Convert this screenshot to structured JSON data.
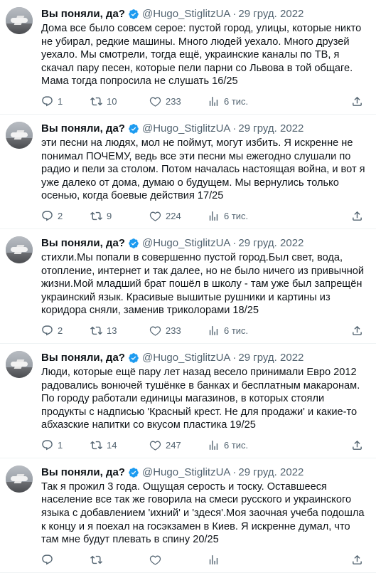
{
  "colors": {
    "text": "#0f1419",
    "muted": "#536471",
    "verified": "#1d9bf0",
    "divider": "#eff3f4"
  },
  "icons": {
    "reply": "reply-icon",
    "retweet": "retweet-icon",
    "like": "heart-icon",
    "views": "views-chart-icon",
    "share": "share-icon",
    "verified": "verified-badge-icon"
  },
  "tweets": [
    {
      "name": "Вы поняли, да?",
      "handle": "@Hugo_StiglitzUA",
      "dot": "·",
      "date": "29 груд. 2022",
      "text": "Дома все было совсем серое: пустой город, улицы, которые никто не убирал, редкие машины. Много людей уехало. Много друзей уехало. Мы смотрели, тогда ещё, украинские каналы по ТВ, я скачал пару песен, которые пели парни со Львова в той общаге. Мама тогда попросила не слушать 16/25",
      "replies": "1",
      "retweets": "10",
      "likes": "233",
      "views": "6 тис."
    },
    {
      "name": "Вы поняли, да?",
      "handle": "@Hugo_StiglitzUA",
      "dot": "·",
      "date": "29 груд. 2022",
      "text": "эти песни на людях, мол не поймут, могут избить. Я искренне не понимал ПОЧЕМУ, ведь все эти песни мы ежегодно слушали по радио и пели за столом. Потом началась настоящая война, и вот я уже далеко от дома, думаю о будущем. Мы вернулись только осенью, когда боевые действия 17/25",
      "replies": "2",
      "retweets": "9",
      "likes": "224",
      "views": "6 тис."
    },
    {
      "name": "Вы поняли, да?",
      "handle": "@Hugo_StiglitzUA",
      "dot": "·",
      "date": "29 груд. 2022",
      "text": "стихли.Мы попали в совершенно пустой город.Был свет, вода, отопление, интернет и так далее, но не было ничего из привычной жизни.Мой младший брат пошёл в школу - там уже был запрещён украинский язык. Красивые вышитые рушники и картины из коридора сняли, заменив триколорами 18/25",
      "replies": "2",
      "retweets": "13",
      "likes": "233",
      "views": "6 тис."
    },
    {
      "name": "Вы поняли, да?",
      "handle": "@Hugo_StiglitzUA",
      "dot": "·",
      "date": "29 груд. 2022",
      "text": "Люди, которые ещё пару лет назад весело принимали Евро 2012 радовались вонючей тушёнке в банках и бесплатным макаронам. По городу работали единицы магазинов, в которых стояли продукты с надписью 'Красный крест. Не для продажи' и какие-то абхазские напитки со вкусом пластика 19/25",
      "replies": "1",
      "retweets": "14",
      "likes": "247",
      "views": "6 тис."
    },
    {
      "name": "Вы поняли, да?",
      "handle": "@Hugo_StiglitzUA",
      "dot": "·",
      "date": "29 груд. 2022",
      "text": "Так я прожил 3 года. Ощущая серость и тоску. Оставшееся население все так же говорила на смеси русского и украинского языка с добавлением 'ихний' и 'здеся'.Моя заочная учеба подошла к концу и я поехал на госэкзамен в Киев. Я искренне думал, что там мне будут плевать в спину 20/25",
      "replies": "",
      "retweets": "",
      "likes": "",
      "views": ""
    }
  ]
}
